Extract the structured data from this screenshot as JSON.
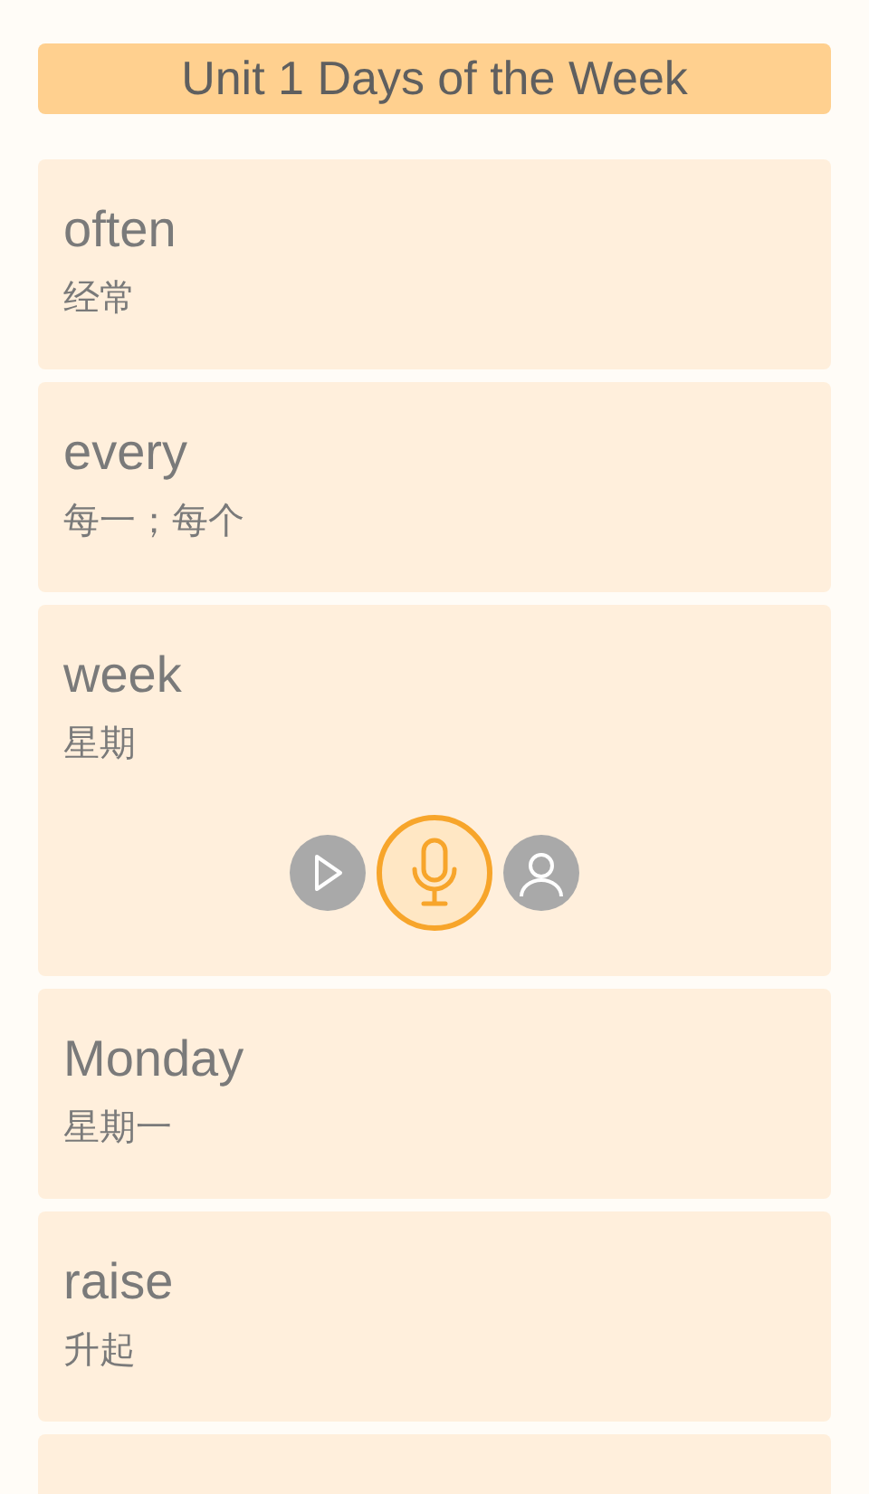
{
  "header": {
    "title": "Unit 1 Days of the Week"
  },
  "words": [
    {
      "word": "often",
      "meaning": "经常",
      "expanded": false
    },
    {
      "word": "every",
      "meaning": "每一；每个",
      "expanded": false
    },
    {
      "word": "week",
      "meaning": "星期",
      "expanded": true
    },
    {
      "word": "Monday",
      "meaning": "星期一",
      "expanded": false
    },
    {
      "word": "raise",
      "meaning": "升起",
      "expanded": false
    }
  ]
}
